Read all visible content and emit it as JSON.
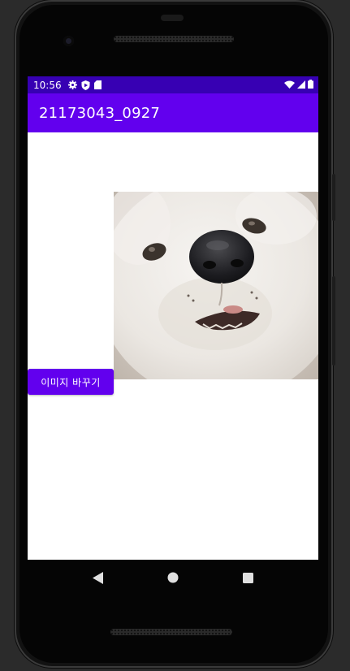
{
  "status_bar": {
    "time": "10:56",
    "left_icons": [
      "gear-icon",
      "shield-icon",
      "sd-card-icon"
    ],
    "right_icons": [
      "wifi-icon",
      "signal-icon",
      "battery-icon"
    ],
    "color": "#3700b3"
  },
  "app_bar": {
    "title": "21173043_0927",
    "color": "#6200ee"
  },
  "content": {
    "image_icon": "dog-photo",
    "button_label": "이미지 바꾸기"
  },
  "nav_bar": {
    "icons": [
      "back-icon",
      "home-icon",
      "recents-icon"
    ]
  }
}
